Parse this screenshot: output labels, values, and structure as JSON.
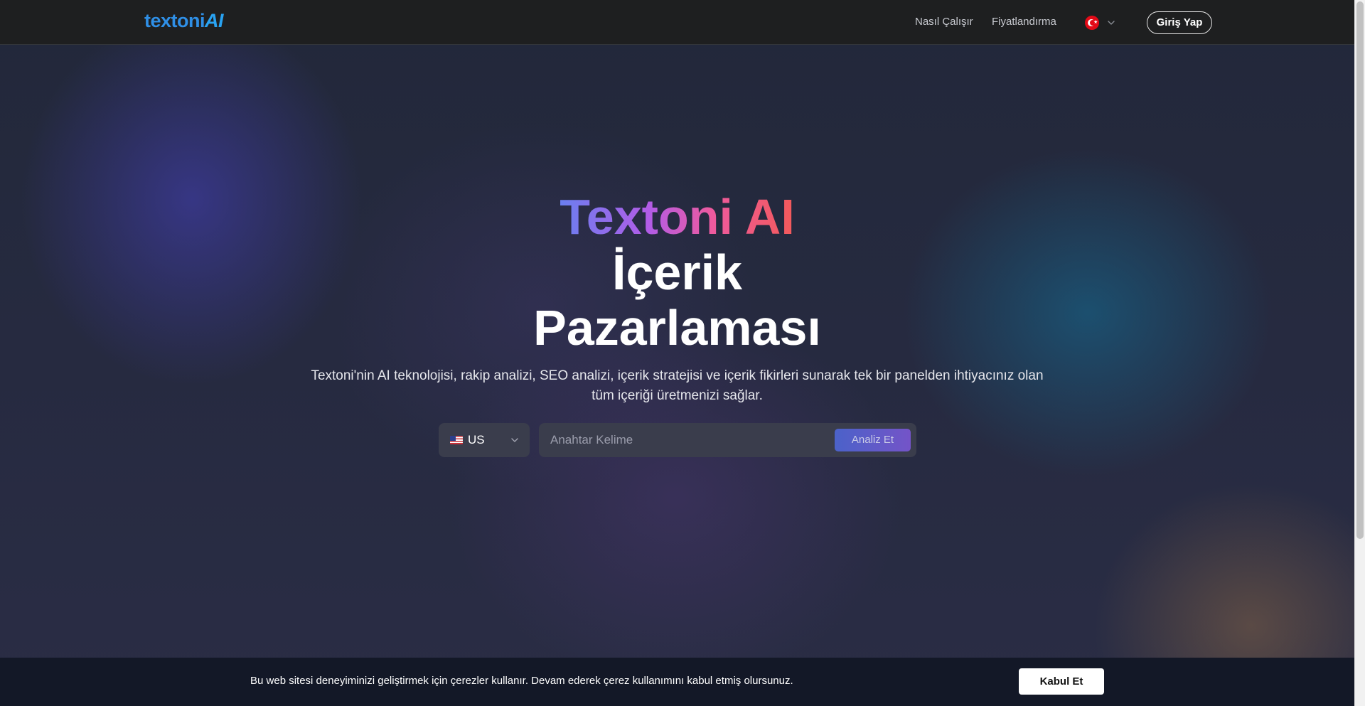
{
  "header": {
    "logo_text": "textoni",
    "logo_suffix": "AI",
    "nav": {
      "how_it_works": "Nasıl Çalışır",
      "pricing": "Fiyatlandırma"
    },
    "language_flag": "turkey-flag-icon",
    "login_label": "Giriş Yap"
  },
  "hero": {
    "brand": "Textoni AI",
    "line2": "İçerik",
    "line3": "Pazarlaması",
    "description": "Textoni'nin AI teknolojisi, rakip analizi, SEO analizi, içerik stratejisi ve içerik fikirleri sunarak tek bir panelden ihtiyacınız olan tüm içeriği üretmenizi sağlar."
  },
  "search": {
    "country_code": "US",
    "country_flag": "us-flag-icon",
    "placeholder": "Anahtar Kelime",
    "value": "",
    "analyze_label": "Analiz Et"
  },
  "cookie": {
    "text": "Bu web sitesi deneyiminizi geliştirmek için çerezler kullanır. Devam ederek çerez kullanımını kabul etmiş olursunuz.",
    "accept_label": "Kabul Et"
  },
  "colors": {
    "header_bg": "#1e1f20",
    "logo_blue": "#2f8fe6",
    "gradient_start": "#6a7ff0",
    "gradient_end": "#f35a5a",
    "analyze_button": "#5a5ccc",
    "cookie_bg": "#131827"
  }
}
